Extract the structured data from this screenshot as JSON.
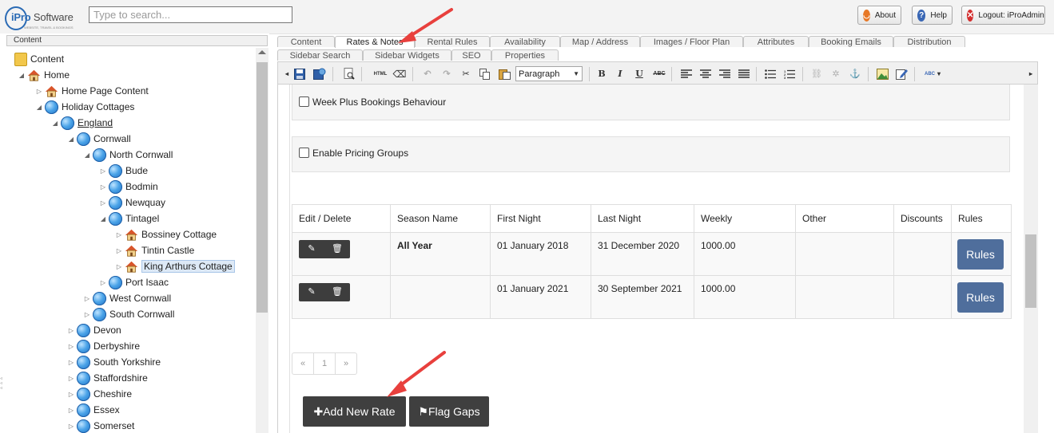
{
  "header": {
    "logo_text": "iPro",
    "logo_text2": " Software",
    "logo_tagline": "WEBSITE, TRAVEL & BOOKINGS",
    "search_placeholder": "Type to search...",
    "about_label": "About",
    "help_label": "Help",
    "logout_label": "Logout: iProAdmin"
  },
  "sidebar": {
    "title": "Content",
    "tree": [
      {
        "label": "Content",
        "icon": "folder-icon"
      },
      {
        "label": "Home",
        "icon": "house-icon"
      },
      {
        "label": "Home Page Content",
        "icon": "house-icon"
      },
      {
        "label": "Holiday Cottages",
        "icon": "globe-icon"
      },
      {
        "label": "England",
        "icon": "globe-icon"
      },
      {
        "label": "Cornwall",
        "icon": "globe-icon"
      },
      {
        "label": "North Cornwall",
        "icon": "globe-icon"
      },
      {
        "label": "Bude",
        "icon": "globe-icon"
      },
      {
        "label": "Bodmin",
        "icon": "globe-icon"
      },
      {
        "label": "Newquay",
        "icon": "globe-icon"
      },
      {
        "label": "Tintagel",
        "icon": "globe-icon"
      },
      {
        "label": "Bossiney Cottage",
        "icon": "house-icon"
      },
      {
        "label": "Tintin Castle",
        "icon": "house-icon"
      },
      {
        "label": "King Arthurs Cottage",
        "icon": "house-icon"
      },
      {
        "label": "Port Isaac",
        "icon": "globe-icon"
      },
      {
        "label": "West Cornwall",
        "icon": "globe-icon"
      },
      {
        "label": "South Cornwall",
        "icon": "globe-icon"
      },
      {
        "label": "Devon",
        "icon": "globe-icon"
      },
      {
        "label": "Derbyshire",
        "icon": "globe-icon"
      },
      {
        "label": "South Yorkshire",
        "icon": "globe-icon"
      },
      {
        "label": "Staffordshire",
        "icon": "globe-icon"
      },
      {
        "label": "Cheshire",
        "icon": "globe-icon"
      },
      {
        "label": "Essex",
        "icon": "globe-icon"
      },
      {
        "label": "Somerset",
        "icon": "globe-icon"
      }
    ]
  },
  "tabs": {
    "row1": [
      "Content",
      "Rates & Notes",
      "Rental Rules",
      "Availability",
      "Map / Address",
      "Images / Floor Plan",
      "Attributes",
      "Booking Emails",
      "Distribution"
    ],
    "row2": [
      "Sidebar Search",
      "Sidebar Widgets",
      "SEO",
      "Properties"
    ],
    "active": "Rates & Notes"
  },
  "editor": {
    "format_select": "Paragraph",
    "buttons": {
      "bold": "B",
      "italic": "I",
      "underline": "U",
      "strike": "ABC",
      "html": "HTML",
      "spell": "ABC"
    }
  },
  "options": {
    "week_plus": "Week Plus Bookings Behaviour",
    "pricing_groups": "Enable Pricing Groups"
  },
  "rates_table": {
    "headers": [
      "Edit / Delete",
      "Season Name",
      "First Night",
      "Last Night",
      "Weekly",
      "Other",
      "Discounts",
      "Rules"
    ],
    "rows": [
      {
        "season": "All Year",
        "first": "01 January 2018",
        "last": "31 December 2020",
        "weekly": "1000.00",
        "other": "",
        "discounts": "",
        "rules": "Rules"
      },
      {
        "season": "",
        "first": "01 January 2021",
        "last": "30 September 2021",
        "weekly": "1000.00",
        "other": "",
        "discounts": "",
        "rules": "Rules"
      }
    ]
  },
  "pagination": {
    "prev": "«",
    "page": "1",
    "next": "»"
  },
  "actions": {
    "add_icon": "✚",
    "add_label": "Add New Rate",
    "flag_icon": "⚑",
    "flag_label": "Flag Gaps"
  },
  "annotation_color": "#e8403d"
}
